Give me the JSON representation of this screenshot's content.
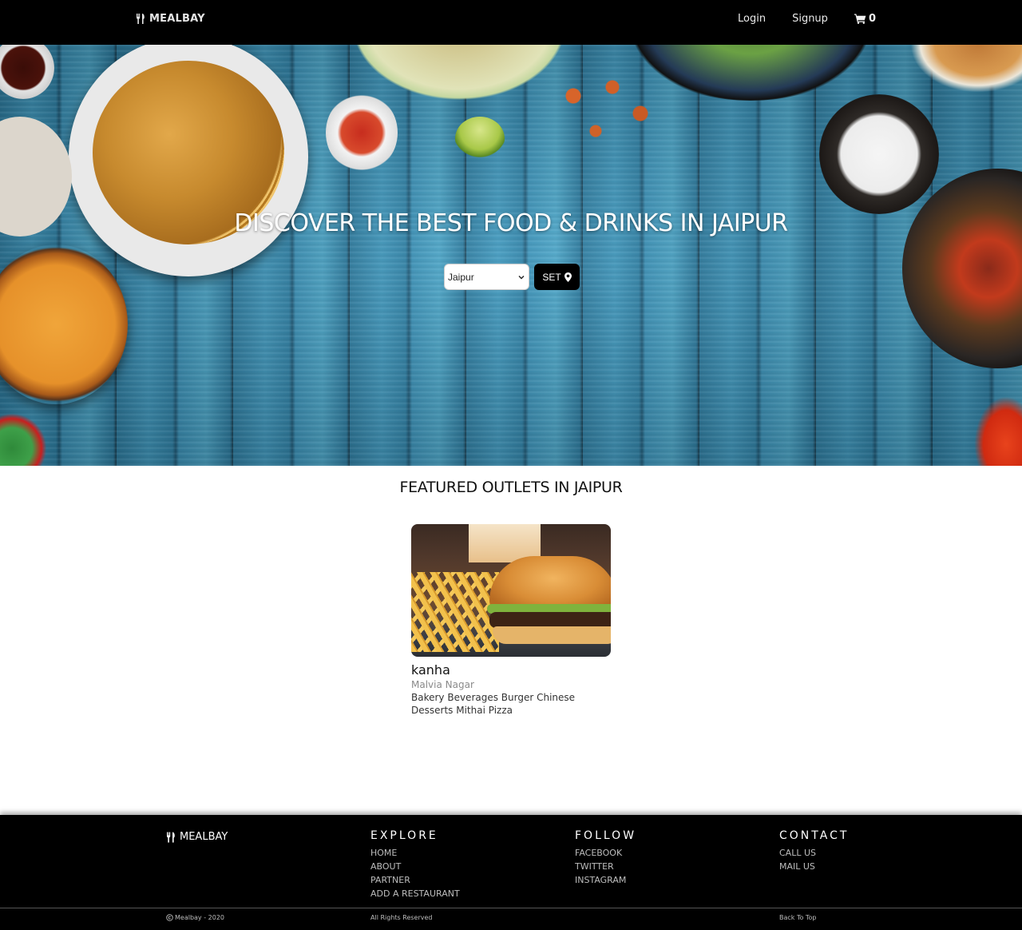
{
  "navbar": {
    "brand": "MEALBAY",
    "brand_icon": "cutlery-icon",
    "login": "Login",
    "signup": "Signup",
    "cart_icon": "cart-icon",
    "cart_count": "0"
  },
  "hero": {
    "title": "DISCOVER THE BEST FOOD & DRINKS IN JAIPUR",
    "city_select_value": "Jaipur",
    "set_button": "SET",
    "set_icon": "map-marker-icon"
  },
  "featured": {
    "title": "FEATURED OUTLETS IN JAIPUR",
    "outlets": [
      {
        "name": "kanha",
        "location": "Malvia Nagar",
        "cuisines": "Bakery Beverages Burger Chinese Desserts Mithai Pizza"
      }
    ]
  },
  "footer": {
    "brand": "MEALBAY",
    "explore": {
      "heading": "EXPLORE",
      "links": [
        "HOME",
        "ABOUT",
        "PARTNER",
        "ADD A RESTAURANT"
      ]
    },
    "follow": {
      "heading": "FOLLOW",
      "links": [
        "FACEBOOK",
        "TWITTER",
        "INSTAGRAM"
      ]
    },
    "contact": {
      "heading": "CONTACT",
      "links": [
        "CALL US",
        "MAIL US"
      ]
    },
    "copyright": "Mealbay - 2020",
    "rights": "All Rights Reserved",
    "back_to_top": "Back To Top"
  },
  "colors": {
    "nav_bg": "#000000",
    "footer_bg": "#000000",
    "hero_wood": "#2d7ea3"
  }
}
